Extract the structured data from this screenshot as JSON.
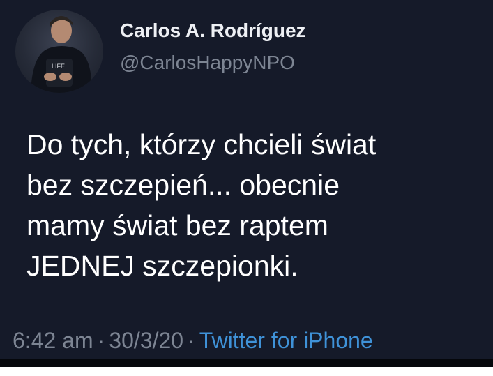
{
  "author": {
    "display_name": "Carlos A. Rodríguez",
    "handle": "@CarlosHappyNPO"
  },
  "tweet": {
    "lines": [
      "Do tych, którzy chcieli świat",
      "bez szczepień... obecnie",
      "mamy świat bez raptem",
      "JEDNEJ szczepionki."
    ]
  },
  "meta": {
    "time": "6:42 am",
    "separator": "·",
    "date": "30/3/20",
    "source": "Twitter for iPhone"
  },
  "colors": {
    "background": "#151a29",
    "text": "#ffffff",
    "muted": "#7d8593",
    "link": "#3f92d8"
  },
  "icons": {
    "avatar": "profile-photo"
  }
}
